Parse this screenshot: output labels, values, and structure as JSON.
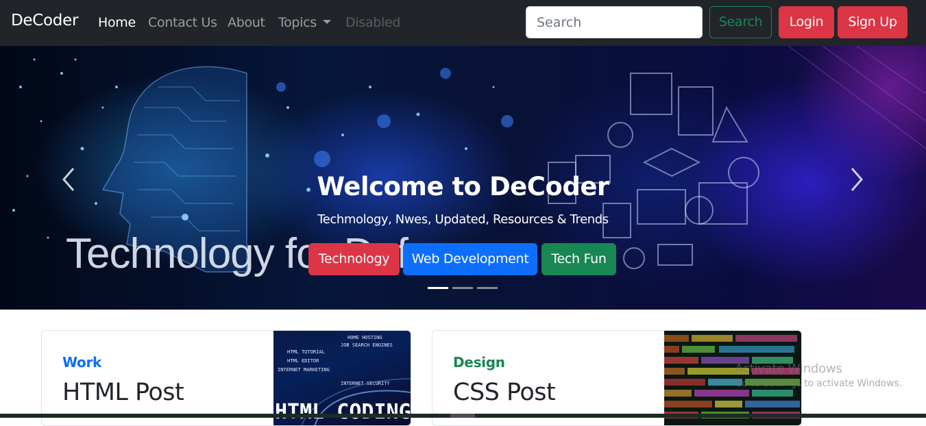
{
  "navbar": {
    "brand": "DeCoder",
    "links": [
      {
        "label": "Home",
        "state": "active"
      },
      {
        "label": "Contact Us",
        "state": "normal"
      },
      {
        "label": "About",
        "state": "normal"
      },
      {
        "label": "Topics",
        "state": "dropdown"
      },
      {
        "label": "Disabled",
        "state": "disabled"
      }
    ],
    "search": {
      "placeholder": "Search",
      "value": ""
    },
    "search_button": "Search",
    "login_button": "Login",
    "signup_button": "Sign Up"
  },
  "carousel": {
    "background_text": "Technology for Defence",
    "title": "Welcome to DeCoder",
    "subtitle": "Techmology, Nwes, Updated, Resources & Trends",
    "buttons": [
      "Technology",
      "Web Development",
      "Tech Fun"
    ],
    "active_slide": 1,
    "slide_count": 3,
    "prev_icon": "chevron-left-icon",
    "next_icon": "chevron-right-icon"
  },
  "cards": [
    {
      "category": "Work",
      "category_color": "#0d6efd",
      "title": "HTML Post",
      "thumb_text": [
        "HOME HOSTING",
        "JOB SEARCH ENGINES",
        "HTML TUTORIAL",
        "HTML EDITOR",
        "INTERNET MARKETING",
        "INTERNET SECURITY",
        "HTML CODING"
      ]
    },
    {
      "category": "Design",
      "category_color": "#198754",
      "title": "CSS Post"
    }
  ],
  "os_watermark": {
    "line1": "Activate Windows",
    "line2": "Go to Settings to activate Windows."
  },
  "colors": {
    "navbar_bg": "#212529",
    "danger": "#dc3545",
    "primary": "#0d6efd",
    "success": "#198754"
  }
}
